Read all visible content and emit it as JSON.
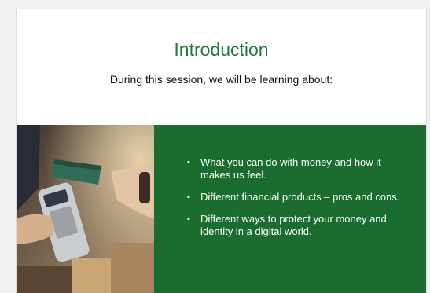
{
  "slide": {
    "title": "Introduction",
    "subtitle": "During this session, we will be learning about:",
    "bullet_glyph": "▪",
    "bullets": [
      "What you can do with money and how it makes us feel.",
      "Different financial products – pros and cons.",
      "Different ways to protect your money and identity in a digital world."
    ],
    "colors": {
      "title": "#1e7a3a",
      "panel": "#1b6d2f",
      "bullet_text": "#ffffff"
    },
    "image_subject": "hand-paying-with-card-at-terminal-photo"
  }
}
